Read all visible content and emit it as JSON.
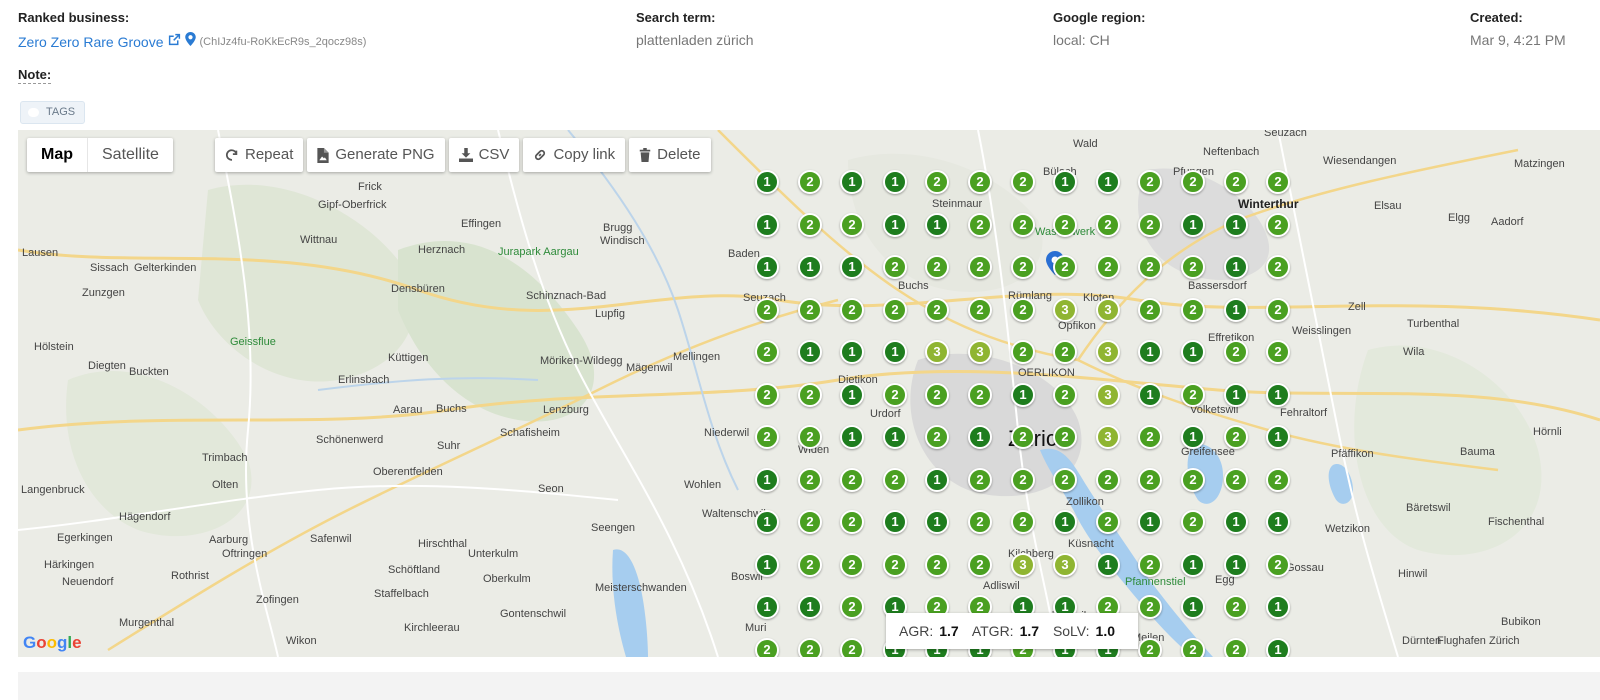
{
  "header": {
    "ranked_business_label": "Ranked business:",
    "business_name": "Zero Zero Rare Groove",
    "place_id": "(ChIJz4fu-RoKkEcR9s_2qocz98s)",
    "search_term_label": "Search term:",
    "search_term": "plattenladen zürich",
    "region_label": "Google region:",
    "region": "local: CH",
    "created_label": "Created:",
    "created": "Mar 9, 4:21 PM"
  },
  "note_label": "Note:",
  "tags_label": "TAGS",
  "map": {
    "type_map": "Map",
    "type_satellite": "Satellite",
    "toolbar": {
      "repeat": "Repeat",
      "generate_png": "Generate PNG",
      "csv": "CSV",
      "copy_link": "Copy link",
      "delete": "Delete"
    },
    "stats": {
      "agr_label": "AGR:",
      "agr": "1.7",
      "atgr_label": "ATGR:",
      "atgr": "1.7",
      "solv_label": "SoLV:",
      "solv": "1.0"
    },
    "attribution": "Google",
    "grid_ranks": [
      [
        1,
        2,
        1,
        1,
        2,
        2,
        2,
        1,
        1,
        2,
        2,
        2,
        2
      ],
      [
        1,
        2,
        2,
        1,
        1,
        2,
        2,
        2,
        2,
        2,
        1,
        1,
        2
      ],
      [
        1,
        1,
        1,
        2,
        2,
        2,
        2,
        2,
        2,
        2,
        2,
        1,
        2
      ],
      [
        2,
        2,
        2,
        2,
        2,
        2,
        2,
        3,
        3,
        2,
        2,
        1,
        2
      ],
      [
        2,
        1,
        1,
        1,
        3,
        3,
        2,
        2,
        3,
        1,
        1,
        2,
        2
      ],
      [
        2,
        2,
        1,
        2,
        2,
        2,
        1,
        2,
        3,
        1,
        2,
        1,
        1
      ],
      [
        2,
        2,
        1,
        1,
        2,
        1,
        2,
        2,
        3,
        2,
        1,
        2,
        1
      ],
      [
        1,
        2,
        2,
        2,
        1,
        2,
        2,
        2,
        2,
        2,
        2,
        2,
        2
      ],
      [
        1,
        2,
        2,
        1,
        1,
        2,
        2,
        1,
        2,
        1,
        2,
        1,
        1
      ],
      [
        1,
        2,
        2,
        2,
        2,
        2,
        3,
        3,
        1,
        2,
        1,
        1,
        2
      ],
      [
        1,
        1,
        2,
        1,
        2,
        2,
        1,
        1,
        2,
        2,
        1,
        2,
        1
      ],
      [
        2,
        2,
        2,
        1,
        1,
        1,
        2,
        1,
        1,
        2,
        2,
        2,
        1
      ]
    ],
    "place_labels": [
      "Frick",
      "Gipf-Oberfrick",
      "Effingen",
      "Brugg",
      "Windisch",
      "Jurapark Aargau",
      "Baden",
      "Wettingen",
      "Schinznach-Bad",
      "Lupfig",
      "Densbüren",
      "Herznach",
      "Zeihen",
      "Wittnau",
      "Sissach",
      "Gelterkinden",
      "Lausen",
      "Zunzgen",
      "Hölstein",
      "Diegten",
      "Buckten",
      "Geissflue",
      "Küttigen",
      "Erlinsbach",
      "Aarau",
      "Buchs",
      "Lenzburg",
      "Möriken-Wildegg",
      "Mägenwil",
      "Mellingen",
      "Niederwil",
      "Schafisheim",
      "Suhr",
      "Schönenwerd",
      "Trimbach",
      "Olten",
      "Oberentfelden",
      "Seon",
      "Wohlen",
      "Langenbruck",
      "Hägendorf",
      "Egerkingen",
      "Härkingen",
      "Neuendorf",
      "Aarburg",
      "Oftringen",
      "Rothrist",
      "Safenwil",
      "Hirschthal",
      "Unterkulm",
      "Oberkulm",
      "Schöftland",
      "Seengen",
      "Meisterschwanden",
      "Staffelbach",
      "Kirchleerau",
      "Gontenschwil",
      "Zofingen",
      "Murgenthal",
      "Wikon",
      "Boswil",
      "Muri",
      "Waltenschwil",
      "Bremgarten",
      "Widen",
      "Urdorf",
      "Dietikon",
      "Spreitenbach",
      "Würenlos",
      "Otelfingen",
      "Buchs",
      "Dielsdorf",
      "Steinmaur",
      "Bachenbülach",
      "Bülach",
      "Embrach",
      "Pfungen",
      "Neftenbach",
      "Winterthur",
      "Seuzach",
      "Elsau",
      "Wiesendangen",
      "Kloten",
      "Rümlang",
      "Opfikon",
      "OERLIKON",
      "Zürich",
      "Dübendorf",
      "Wallisellen",
      "Dietlikon",
      "Bassersdorf",
      "Effretikon",
      "Volketswil",
      "Fehraltorf",
      "Uster",
      "Greifensee",
      "Pfäffikon",
      "Wetzikon",
      "Zollikon",
      "Küsnacht",
      "Kilchberg",
      "Adliswil",
      "Thalwil",
      "Meilen",
      "Egg",
      "Pfannenstiel",
      "Gossau",
      "Hinwil",
      "Bäretswil",
      "Fischenthal",
      "Bauma",
      "Wila",
      "Turbenthal",
      "Zell",
      "Weisslingen",
      "Elgg",
      "Aadorf",
      "Matzingen",
      "Hörnli",
      "Neuenhof",
      "Seuzach",
      "Rorbas",
      "Wald",
      "Bubikon",
      "Dürnten",
      "Flughafen Zürich",
      "Wasserwerk"
    ]
  }
}
